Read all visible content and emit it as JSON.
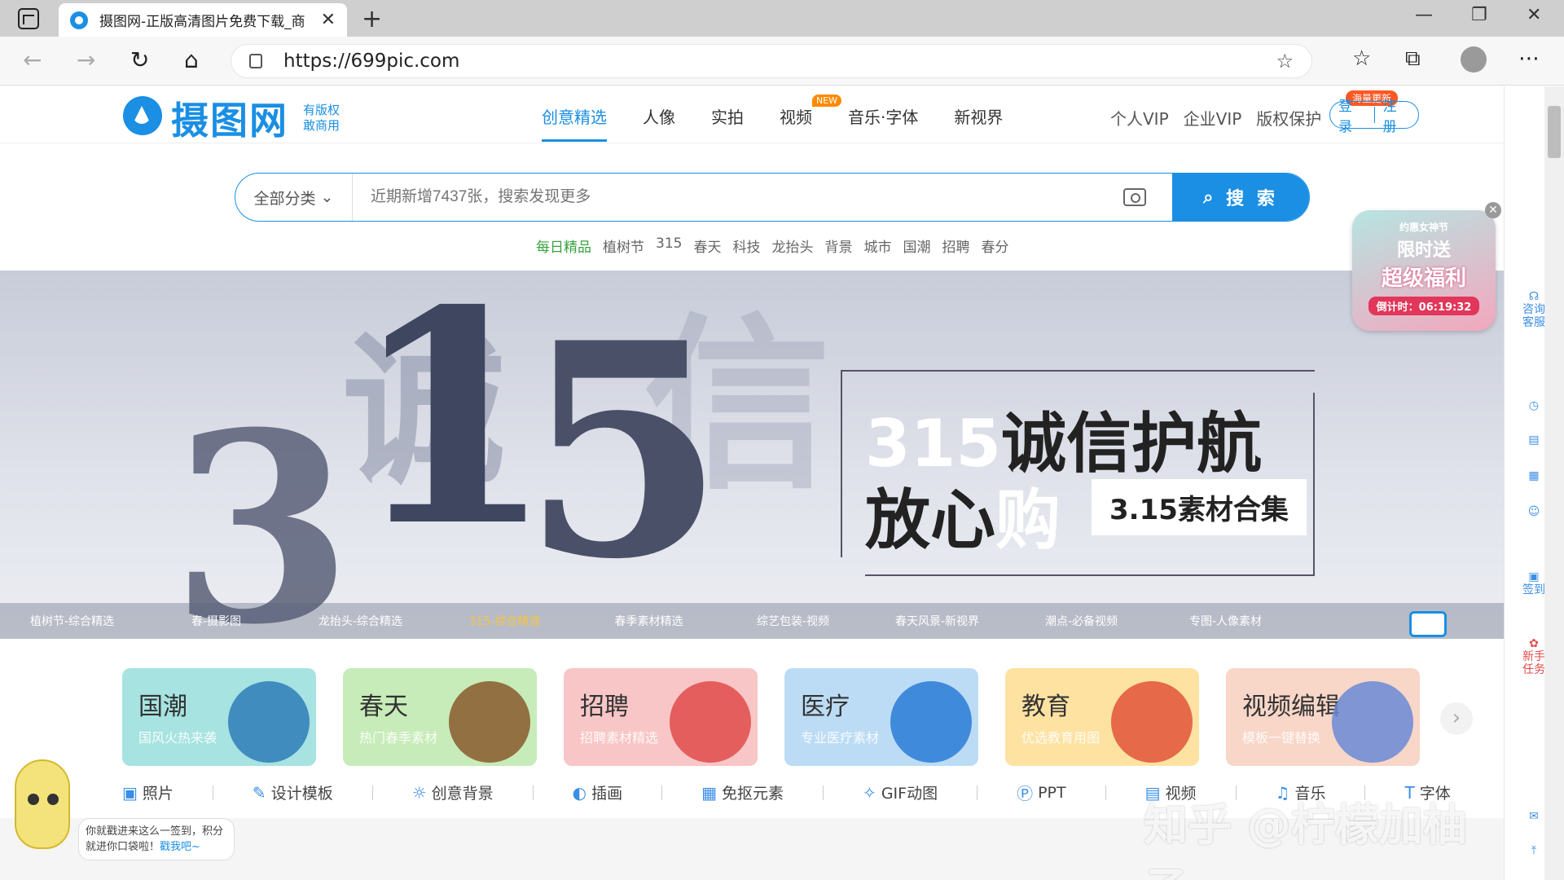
{
  "browser": {
    "tab_title": "摄图网-正版高清图片免费下载_商",
    "url": "https://699pic.com",
    "close_glyph": "✕",
    "new_tab_glyph": "+"
  },
  "header": {
    "logo_text": "摄图网",
    "logo_sub": "有版权 敢商用",
    "nav": [
      {
        "label": "创意精选",
        "active": true
      },
      {
        "label": "人像"
      },
      {
        "label": "实拍"
      },
      {
        "label": "视频",
        "badge": "NEW"
      },
      {
        "label": "音乐·字体"
      },
      {
        "label": "新视界"
      }
    ],
    "right_links": [
      "个人VIP",
      "企业VIP",
      "版权保护"
    ],
    "hot_badge": "海量更新",
    "login": "登录",
    "register": "注册"
  },
  "search": {
    "category": "全部分类",
    "placeholder": "近期新增7437张，搜索发现更多",
    "button": "搜 索",
    "hot_tags": [
      "每日精品",
      "植树节",
      "315",
      "春天",
      "科技",
      "龙抬头",
      "背景",
      "城市",
      "国潮",
      "招聘",
      "春分"
    ]
  },
  "banner": {
    "title_line1_a": "315",
    "title_line1_b": "诚信护航",
    "title_line2_a": "放心",
    "title_line2_b": "购",
    "tag": "3.15素材合集",
    "nav": [
      "植树节-综合精选",
      "春-摄影图",
      "龙抬头-综合精选",
      "315-综合精选",
      "春季素材精选",
      "综艺包装-视频",
      "春天风景-新视界",
      "潮点-必备视频",
      "专图-人像素材"
    ],
    "active_index": 3
  },
  "promo": {
    "line1": "约惠女神节",
    "line2": "限时送",
    "line3": "超级福利",
    "countdown": "倒计时：06:19:32"
  },
  "side_rail": {
    "service": "咨询客服",
    "checkin": "签到",
    "task": "新手任务"
  },
  "cards": [
    {
      "title": "国潮",
      "sub": "国风火热来袭",
      "color": "#a6e3e1",
      "deco": "#2f7db8"
    },
    {
      "title": "春天",
      "sub": "热门春季素材",
      "color": "#c7ecb9",
      "deco": "#8a5a2b"
    },
    {
      "title": "招聘",
      "sub": "招聘素材精选",
      "color": "#f8c6c6",
      "deco": "#e04b4b"
    },
    {
      "title": "医疗",
      "sub": "专业医疗素材",
      "color": "#bcdcf5",
      "deco": "#2a7bd6"
    },
    {
      "title": "教育",
      "sub": "优选教育用图",
      "color": "#fde2a2",
      "deco": "#e2543a"
    },
    {
      "title": "视频编辑",
      "sub": "模板一键替换",
      "color": "#f8d6c8",
      "deco": "#6a89d6"
    }
  ],
  "categories": [
    {
      "icon": "image-icon",
      "glyph": "▣",
      "label": "照片"
    },
    {
      "icon": "design-icon",
      "glyph": "✎",
      "label": "设计模板"
    },
    {
      "icon": "bulb-icon",
      "glyph": "☼",
      "label": "创意背景"
    },
    {
      "icon": "palette-icon",
      "glyph": "◐",
      "label": "插画"
    },
    {
      "icon": "grid-icon",
      "glyph": "▦",
      "label": "免抠元素"
    },
    {
      "icon": "sparkle-icon",
      "glyph": "✧",
      "label": "GIF动图"
    },
    {
      "icon": "ppt-icon",
      "glyph": "Ⓟ",
      "label": "PPT"
    },
    {
      "icon": "video-icon",
      "glyph": "▤",
      "label": "视频"
    },
    {
      "icon": "music-icon",
      "glyph": "♫",
      "label": "音乐"
    },
    {
      "icon": "font-icon",
      "glyph": "T",
      "label": "字体"
    }
  ],
  "mascot_bubble": {
    "text": "你就戳进来这么一签到，积分就进你口袋啦！",
    "link": "戳我吧~"
  },
  "watermark": "知乎 @柠檬加柚子"
}
